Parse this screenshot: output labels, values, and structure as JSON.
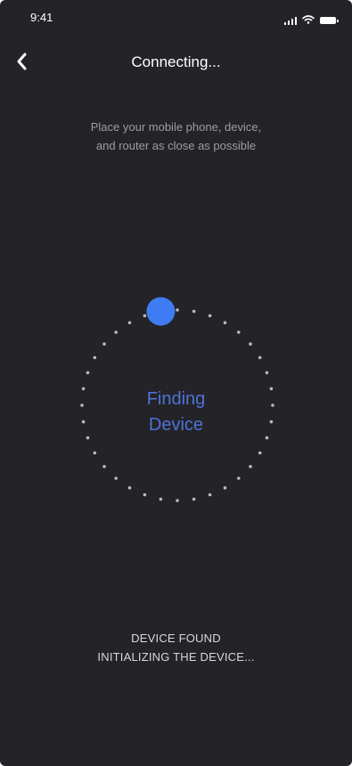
{
  "status_bar": {
    "time": "9:41",
    "icons": [
      "cellular-signal-icon",
      "wifi-icon",
      "battery-icon"
    ]
  },
  "nav": {
    "back_icon": "chevron-left-icon",
    "title": "Connecting..."
  },
  "instruction": {
    "line1": "Place your mobile phone, device,",
    "line2": "and router as close as possible"
  },
  "finder": {
    "label_line1": "Finding",
    "label_line2": "Device",
    "accent_color": "#3f7cf4",
    "dot_color": "#b9b9be"
  },
  "status_message": {
    "line1": "DEVICE FOUND",
    "line2": "INITIALIZING THE DEVICE..."
  },
  "colors": {
    "background": "#232328",
    "label_blue": "#4f73d6"
  }
}
